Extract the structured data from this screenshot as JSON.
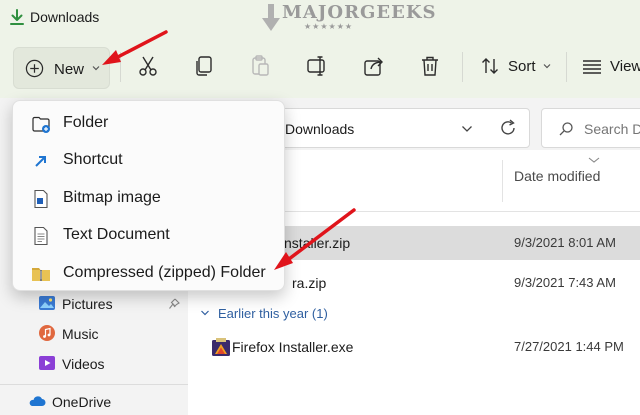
{
  "window": {
    "title": "Downloads"
  },
  "watermark": {
    "brand": "MAJORGEEKS",
    "stars": "★★★★★★"
  },
  "toolbar": {
    "new_label": "New",
    "sort_label": "Sort",
    "view_label": "View"
  },
  "address": {
    "crumb": "Downloads"
  },
  "search": {
    "placeholder": "Search D"
  },
  "columns": {
    "date_modified": "Date modified"
  },
  "files": [
    {
      "name": "nstaller.zip",
      "date": "9/3/2021 8:01 AM"
    },
    {
      "name": "ra.zip",
      "date": "9/3/2021 7:43 AM"
    }
  ],
  "group": {
    "label": "Earlier this year (1)"
  },
  "files_earlier": [
    {
      "name": "Firefox Installer.exe",
      "date": "7/27/2021 1:44 PM"
    }
  ],
  "nav": {
    "items": [
      {
        "label": "Pictures"
      },
      {
        "label": "Music"
      },
      {
        "label": "Videos"
      },
      {
        "label": "OneDrive"
      }
    ]
  },
  "new_menu": {
    "items": [
      {
        "label": "Folder",
        "icon": "folder-new-icon"
      },
      {
        "label": "Shortcut",
        "icon": "shortcut-icon"
      },
      {
        "label": "Bitmap image",
        "icon": "bitmap-icon"
      },
      {
        "label": "Text Document",
        "icon": "text-document-icon"
      },
      {
        "label": "Compressed (zipped) Folder",
        "icon": "zip-folder-icon"
      }
    ]
  },
  "colors": {
    "accent": "#005fb8",
    "arrow": "#e0141b",
    "toolbar_bg": "#eef3e8",
    "selected_row": "#dcdcdc"
  }
}
